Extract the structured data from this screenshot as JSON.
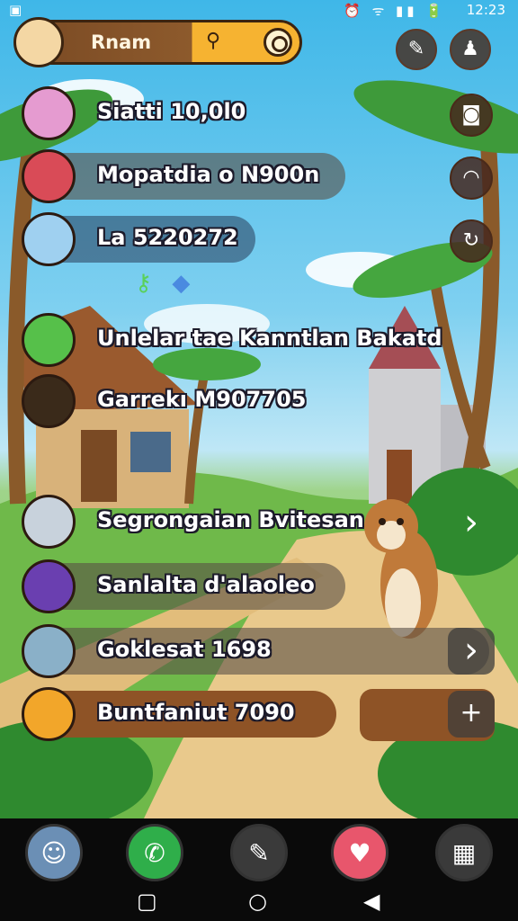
{
  "status_bar": {
    "time": "12:23",
    "left_icon": "sim-icon",
    "indicators": "⏰ ᯤ ▮▮ 🔋"
  },
  "player": {
    "name": "Rnam"
  },
  "top_buttons": [
    {
      "icon": "torch-icon",
      "glyph": "✎"
    },
    {
      "icon": "profile-icon",
      "glyph": "♟"
    }
  ],
  "side_buttons": [
    {
      "icon": "camera-icon",
      "glyph": "◙"
    },
    {
      "icon": "portal-icon",
      "glyph": "◠"
    },
    {
      "icon": "refresh-icon",
      "glyph": "↻"
    }
  ],
  "rows": [
    {
      "label": "Siatti 10,0l0",
      "avatar_color": "#e59bd0",
      "style": "none"
    },
    {
      "label": "Mopatdia o N900n",
      "avatar_color": "#d94b57",
      "style": "gray"
    },
    {
      "label": "La 5220272",
      "avatar_color": "#9fd0f0",
      "style": "blue"
    },
    {
      "label": "Unlelar tae Kanntlan Bakatd",
      "avatar_color": "#56c04a",
      "style": "none"
    },
    {
      "label": "Garrekı M907705",
      "avatar_color": "#3a2a1a",
      "style": "none"
    },
    {
      "label": "Segrongaian Bvitesan",
      "avatar_color": "#c8d2dc",
      "style": "none"
    },
    {
      "label": "Sanlalta d'alaoleo",
      "avatar_color": "#6a3fb0",
      "style": "gray"
    },
    {
      "label": "Goklesat 1698",
      "avatar_color": "#8ab0c8",
      "style": "gray"
    },
    {
      "label": "Buntfaniut 7090",
      "avatar_color": "#f2a62a",
      "style": "brown"
    }
  ],
  "right_arrows": [
    {
      "icon": "chevron-right-icon",
      "glyph": "›"
    },
    {
      "icon": "chevron-right-icon",
      "glyph": "›"
    },
    {
      "icon": "plus-icon",
      "glyph": "+"
    }
  ],
  "bottom_nav": [
    {
      "name": "avatar-icon",
      "bg": "#6b8fb5",
      "glyph": "☺"
    },
    {
      "name": "phone-icon",
      "bg": "#2fae4a",
      "glyph": "✆"
    },
    {
      "name": "edit-icon",
      "bg": "#3a3a3a",
      "glyph": "✎"
    },
    {
      "name": "pet-icon",
      "bg": "#e8566c",
      "glyph": "♥"
    },
    {
      "name": "grid-icon",
      "bg": "#3a3a3a",
      "glyph": "▦"
    }
  ],
  "system_nav": {
    "recent": "▢",
    "home": "○",
    "back": "◀"
  }
}
